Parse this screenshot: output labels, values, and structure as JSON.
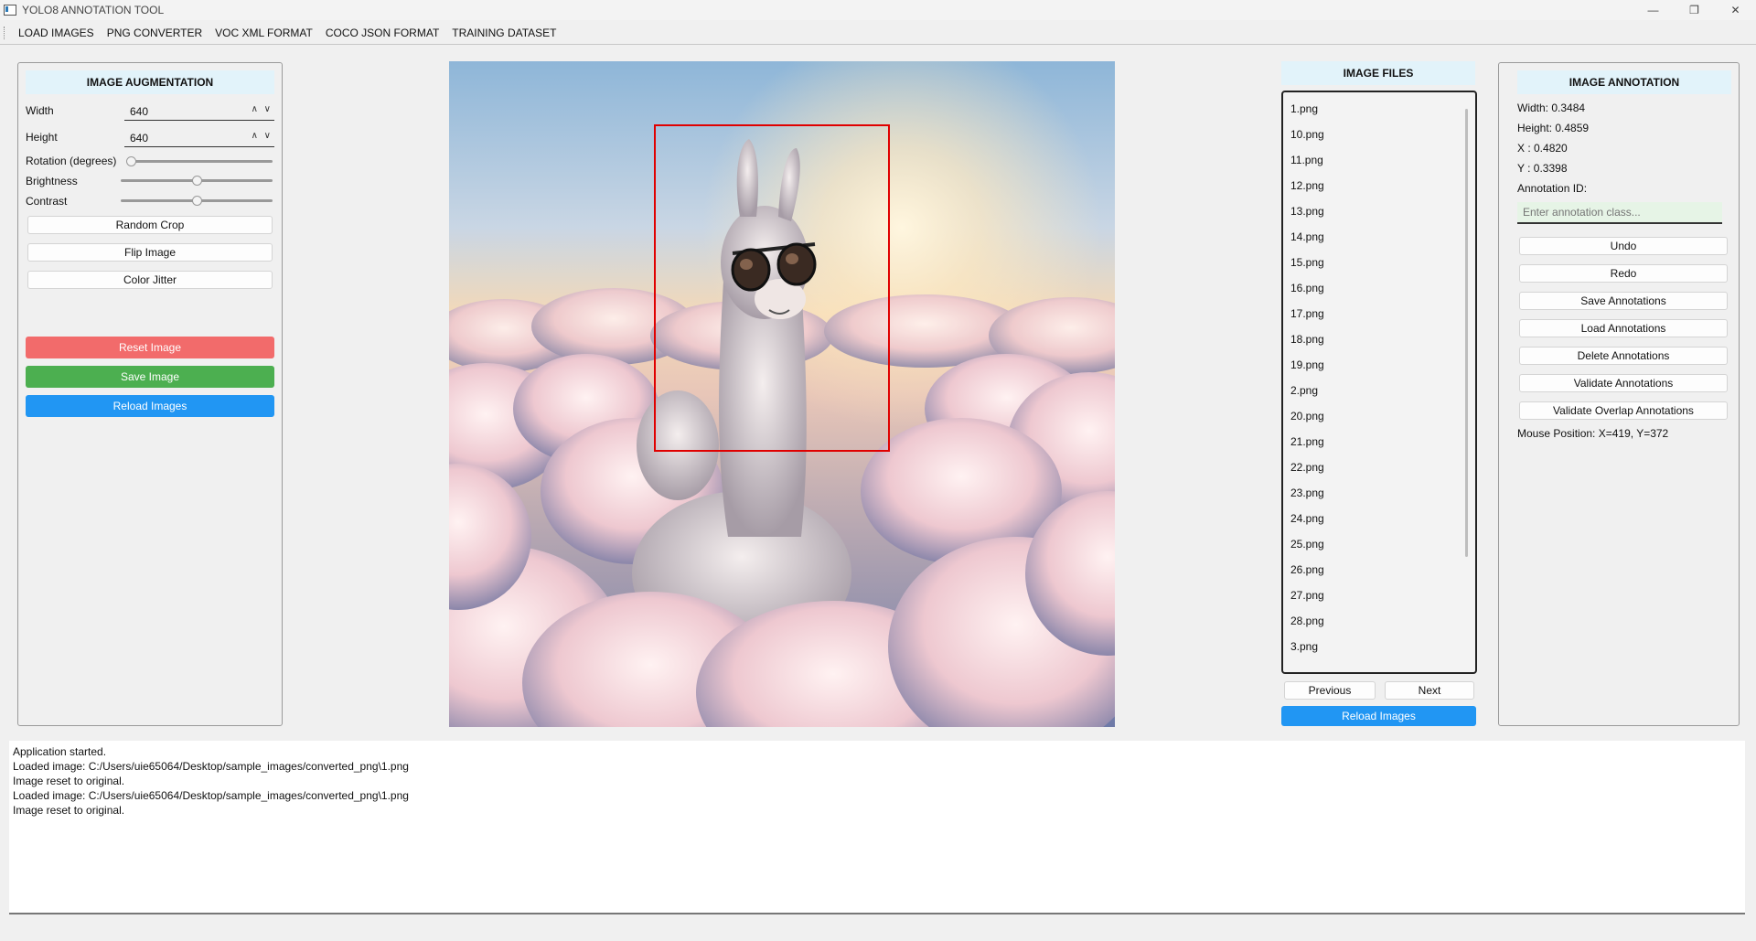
{
  "window": {
    "title": "YOLO8 ANNOTATION TOOL",
    "controls": [
      "—",
      "❐",
      "✕"
    ]
  },
  "menu": [
    "LOAD IMAGES",
    "PNG CONVERTER",
    "VOC XML FORMAT",
    "COCO JSON FORMAT",
    "TRAINING DATASET"
  ],
  "augmentation": {
    "title": "IMAGE AUGMENTATION",
    "width_label": "Width",
    "width_value": "640",
    "height_label": "Height",
    "height_value": "640",
    "rotation_label": "Rotation (degrees)",
    "rotation_level": 0,
    "brightness_label": "Brightness",
    "brightness_level": 0.5,
    "contrast_label": "Contrast",
    "contrast_level": 0.5,
    "random_crop": "Random Crop",
    "flip_image": "Flip Image",
    "color_jitter": "Color Jitter",
    "reset_image": "Reset Image",
    "save_image": "Save Image",
    "reload_images": "Reload Images",
    "colors": {
      "reset": "#f26b6b",
      "save": "#4caf50",
      "reload": "#2196f3"
    }
  },
  "canvas": {
    "image_alt": "llama wearing sunglasses above clouds",
    "bbox_color": "#e00000"
  },
  "files": {
    "title": "IMAGE FILES",
    "items": [
      "1.png",
      "10.png",
      "11.png",
      "12.png",
      "13.png",
      "14.png",
      "15.png",
      "16.png",
      "17.png",
      "18.png",
      "19.png",
      "2.png",
      "20.png",
      "21.png",
      "22.png",
      "23.png",
      "24.png",
      "25.png",
      "26.png",
      "27.png",
      "28.png",
      "3.png"
    ],
    "previous": "Previous",
    "next": "Next",
    "reload": "Reload Images"
  },
  "annotation": {
    "title": "IMAGE ANNOTATION",
    "width_line": "Width: 0.3484",
    "height_line": "Height: 0.4859",
    "x_line": "X : 0.4820",
    "y_line": "Y : 0.3398",
    "id_label": "Annotation ID:",
    "class_placeholder": "Enter annotation class...",
    "undo": "Undo",
    "redo": "Redo",
    "save": "Save Annotations",
    "load": "Load Annotations",
    "delete": "Delete Annotations",
    "validate": "Validate Annotations",
    "validate_overlap": "Validate Overlap Annotations",
    "mouse_position": "Mouse Position: X=419, Y=372"
  },
  "log": [
    "Application started.",
    "Loaded image: C:/Users/uie65064/Desktop/sample_images/converted_png\\1.png",
    "Image reset to original.",
    "Loaded image: C:/Users/uie65064/Desktop/sample_images/converted_png\\1.png",
    "Image reset to original."
  ]
}
